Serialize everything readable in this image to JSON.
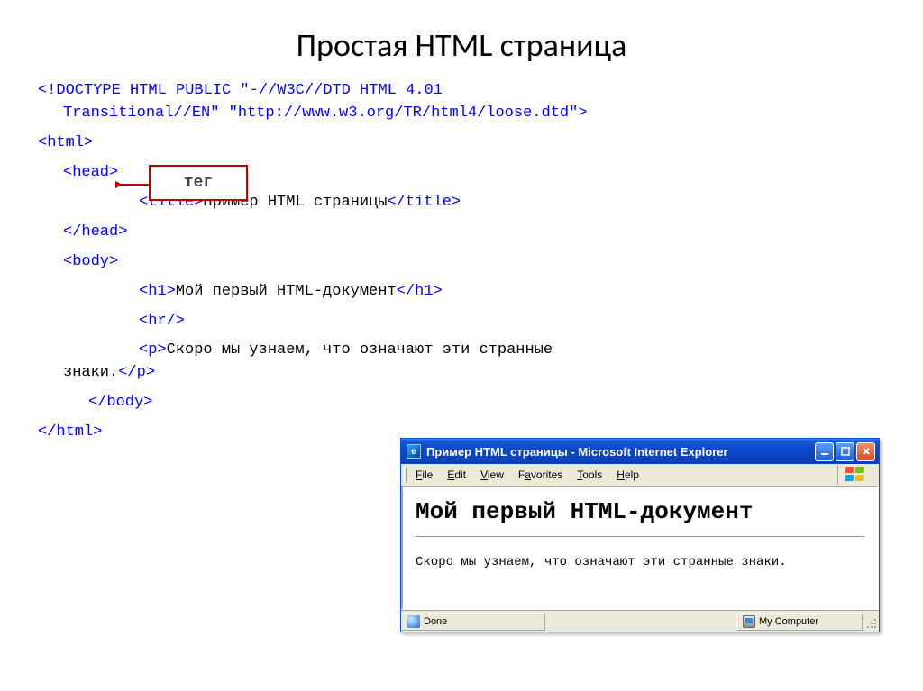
{
  "slide": {
    "title": "Простая HTML страница",
    "callout_label": "тег"
  },
  "code": {
    "doctype1": "<!DOCTYPE HTML PUBLIC \"-//W3C//DTD HTML 4.01",
    "doctype2": "Transitional//EN\" \"http://www.w3.org/TR/html4/loose.dtd\">",
    "html_open": "<html>",
    "head_open": "<head>",
    "title_open": "<title>",
    "title_text": "Пример HTML страницы",
    "title_close": "</title>",
    "head_close": "</head>",
    "body_open": "<body>",
    "h1_open": "<h1>",
    "h1_text": "Мой первый HTML-документ",
    "h1_close": "</h1>",
    "hr": "<hr/>",
    "p_open": "<p>",
    "p_text1": "Скоро мы узнаем, что означают эти странные",
    "p_text2": "знаки.",
    "p_close": "</p>",
    "body_close": "</body>",
    "html_close": "</html>"
  },
  "browser": {
    "title": "Пример HTML страницы - Microsoft Internet Explorer",
    "menu": {
      "file": "File",
      "edit": "Edit",
      "view": "View",
      "favorites": "Favorites",
      "tools": "Tools",
      "help": "Help"
    },
    "page": {
      "h1": "Мой первый HTML-документ",
      "p": "Скоро мы узнаем, что означают эти странные знаки."
    },
    "status": {
      "done": "Done",
      "zone": "My Computer"
    }
  }
}
